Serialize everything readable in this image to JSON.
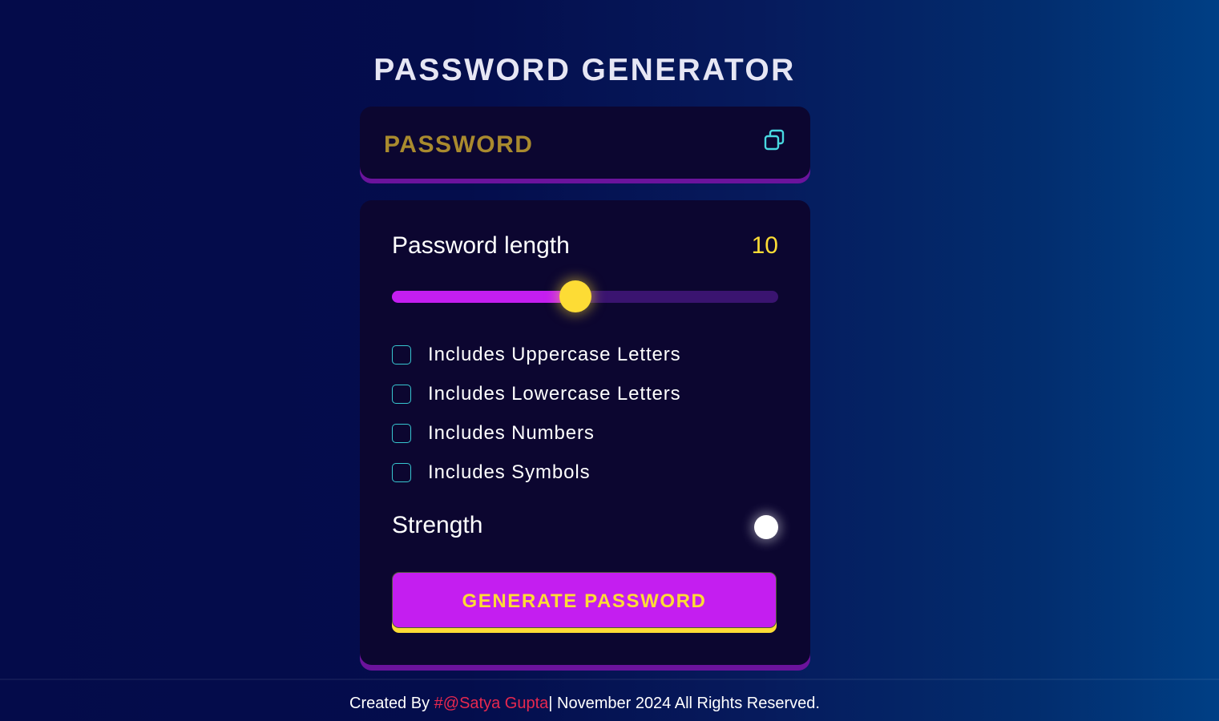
{
  "header": {
    "title": "PASSWORD GENERATOR"
  },
  "display": {
    "password_text": "PASSWORD",
    "copy_icon": "copy-icon"
  },
  "settings": {
    "length_label": "Password length",
    "length_value": "10",
    "slider_progress": 0.475,
    "options": [
      {
        "label": "Includes Uppercase Letters",
        "checked": false
      },
      {
        "label": "Includes Lowercase Letters",
        "checked": false
      },
      {
        "label": "Includes Numbers",
        "checked": false
      },
      {
        "label": "Includes Symbols",
        "checked": false
      }
    ],
    "strength_label": "Strength",
    "generate_label": "GENERATE PASSWORD"
  },
  "footer": {
    "prefix": "Created By ",
    "author_link": "#@Satya Gupta",
    "suffix": "| November 2024 All Rights Reserved."
  },
  "colors": {
    "accent_purple": "#c41ef0",
    "accent_yellow": "#fddc35",
    "checkbox_teal": "#37c6d0",
    "panel_bg": "#0c0630",
    "link_red": "#e8284f"
  }
}
